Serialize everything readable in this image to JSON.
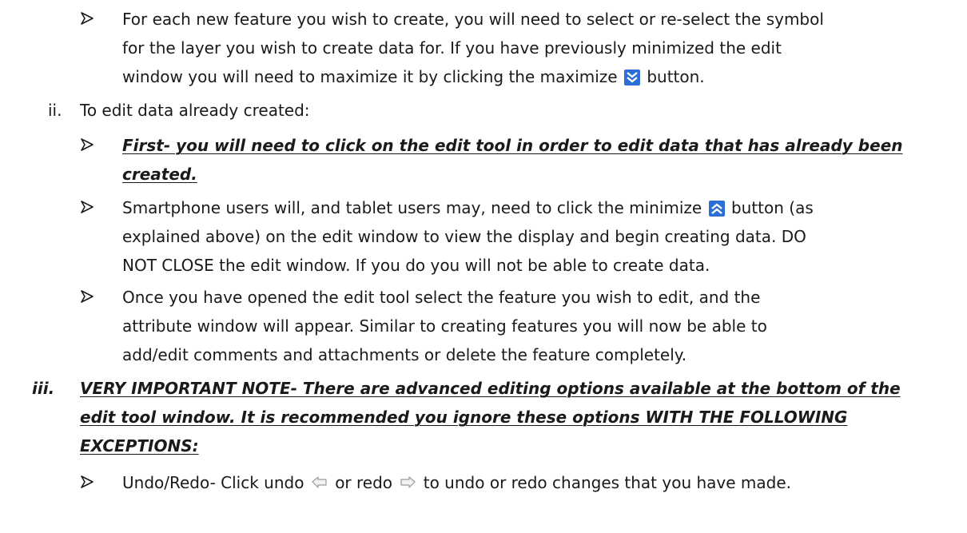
{
  "doc": {
    "b1": {
      "l1": "For each new feature you wish to create, you will need to select or re-select the symbol",
      "l2": "for the layer you wish to create data for.  If you have previously minimized the edit",
      "l3a": "window you will need to maximize it by clicking the maximize",
      "l3b": "button."
    },
    "ii": {
      "label": "ii.",
      "text": "To edit data already created:"
    },
    "b2": {
      "l1": "First- you will need to click on the edit tool in order to edit data that has already been",
      "l2": "created."
    },
    "b3": {
      "l1a": "Smartphone users will, and tablet users may, need to click the minimize",
      "l1b": "button (as",
      "l2": "explained above) on the edit window to view the display and begin creating data.  DO",
      "l3": "NOT CLOSE the edit window.  If you do you will not be able to create data."
    },
    "b4": {
      "l1": "Once you have opened the edit tool select the feature you wish to edit, and the",
      "l2": "attribute window will appear.  Similar to creating features you will now be able to",
      "l3": "add/edit comments and attachments or delete the feature completely."
    },
    "iii": {
      "label": "iii.",
      "l1": "VERY IMPORTANT NOTE- There are advanced editing options available at the bottom of the",
      "l2": "edit tool window.  It is recommended you ignore these options WITH THE FOLLOWING",
      "l3": "EXCEPTIONS:"
    },
    "b5": {
      "a": "Undo/Redo- Click undo",
      "b": "or redo",
      "c": "to undo or redo changes that you have made."
    }
  },
  "icons": {
    "maximize": "double-chevron-down-icon",
    "minimize": "double-chevron-up-icon",
    "undo": "undo-arrow-icon",
    "redo": "redo-arrow-icon",
    "accent": "#2b6fd6"
  }
}
